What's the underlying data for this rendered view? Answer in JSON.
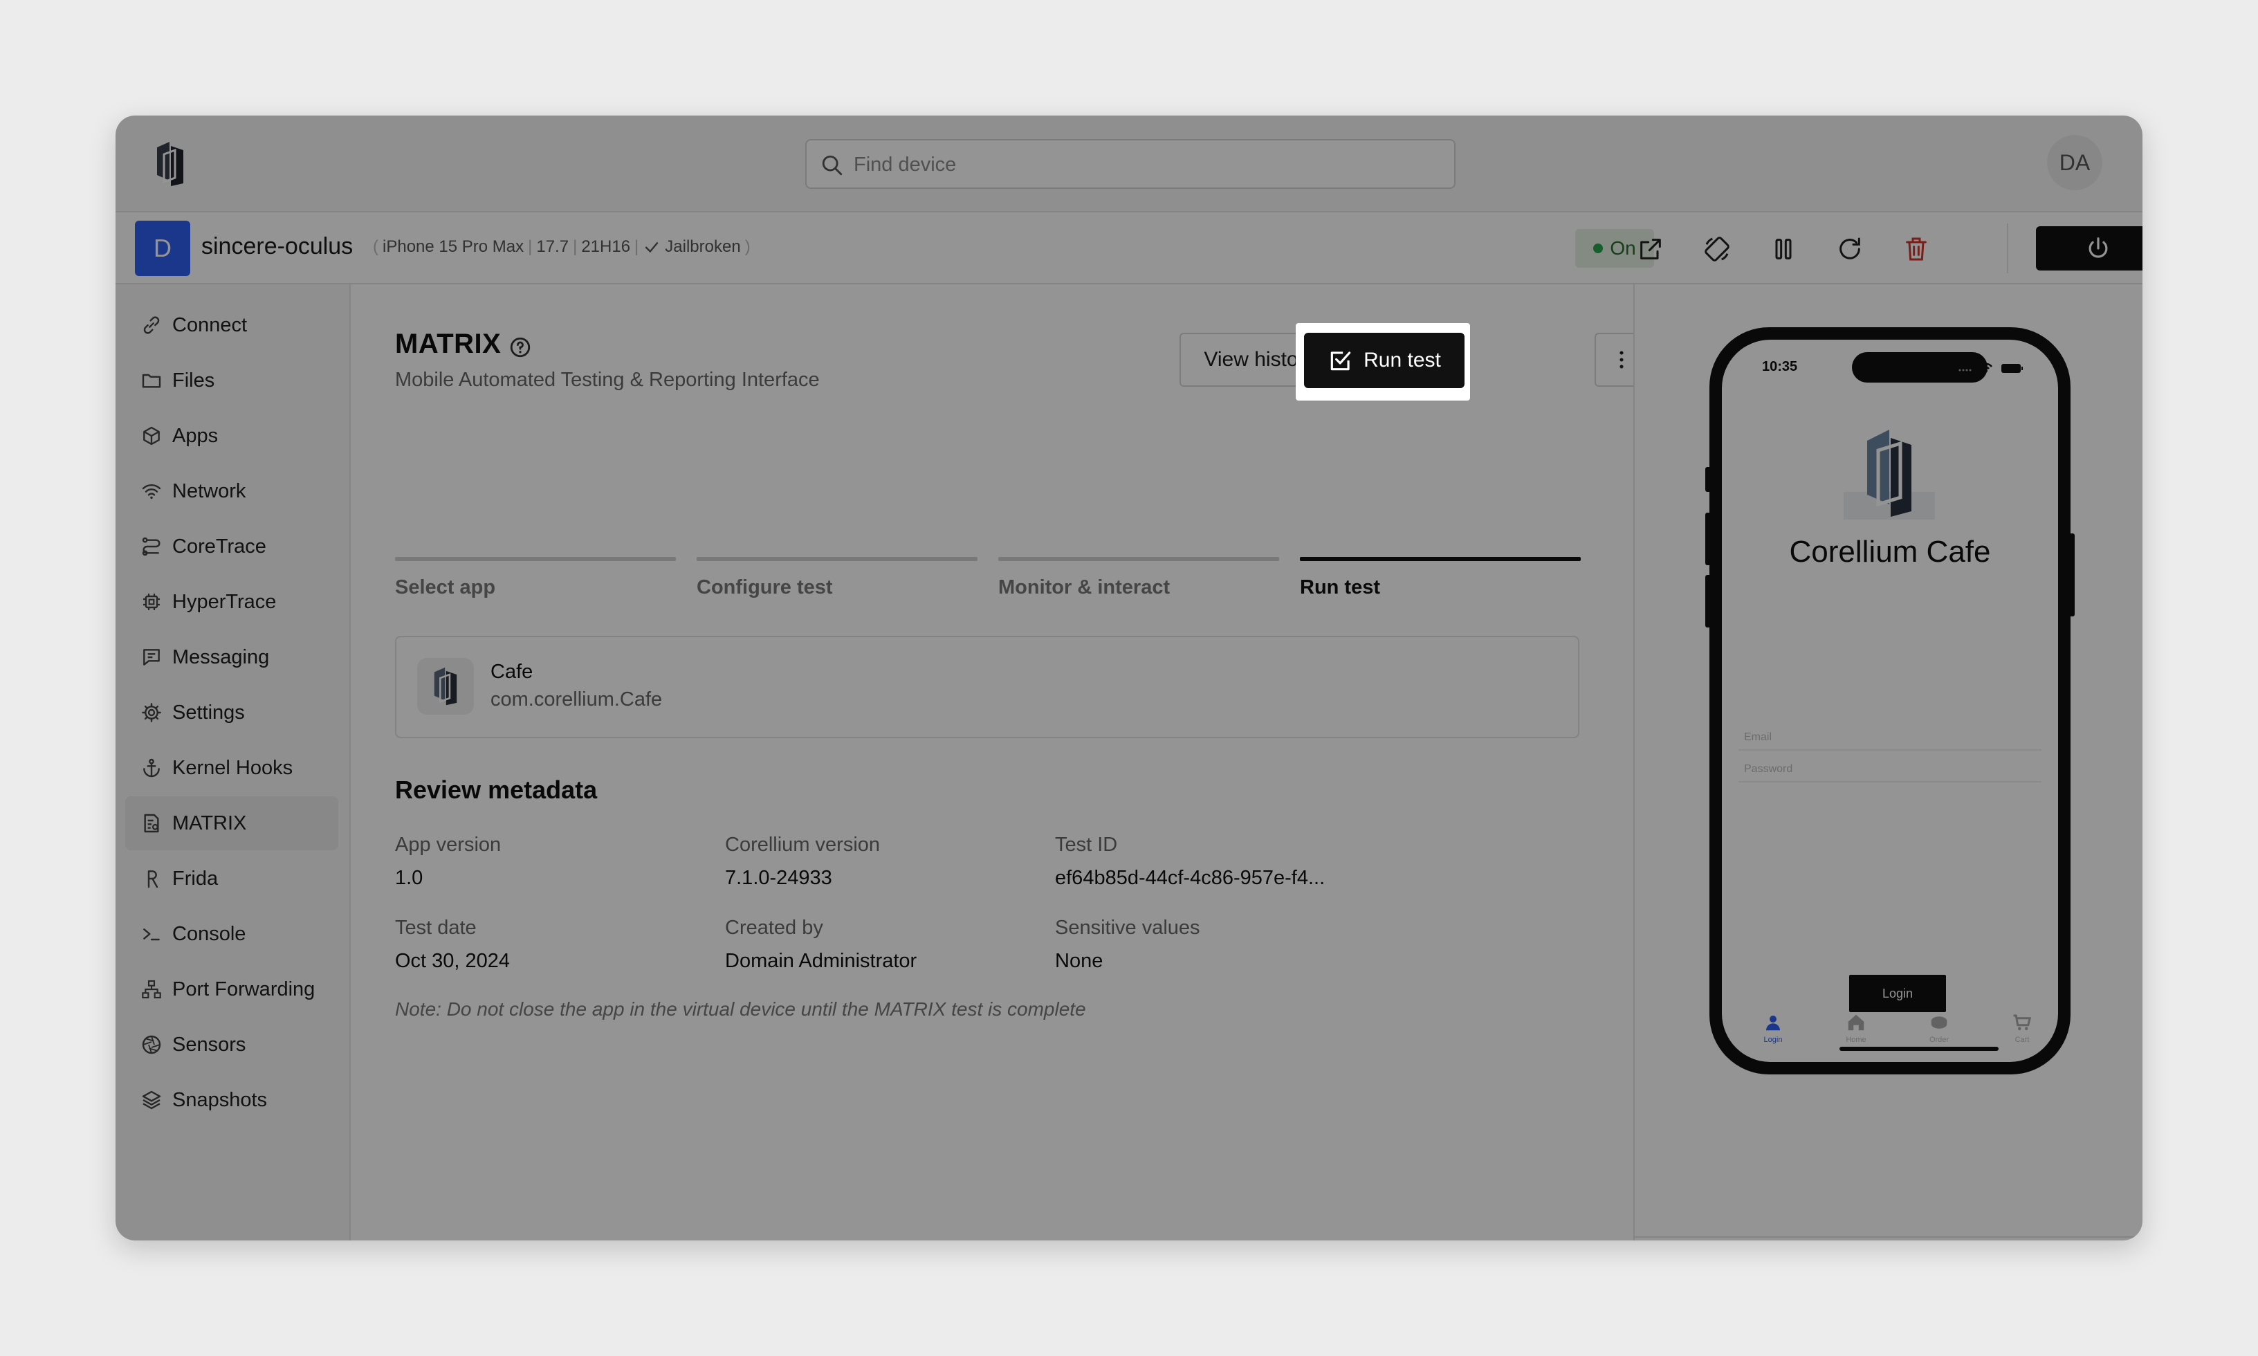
{
  "header": {
    "search_placeholder": "Find device",
    "user_initials": "DA"
  },
  "device": {
    "badge": "D",
    "name": "sincere-oculus",
    "model": "iPhone 15 Pro Max",
    "os_version": "17.7",
    "build": "21H16",
    "jailbreak": "Jailbroken",
    "status": "On",
    "status_color": "#27a34a",
    "toolbar_icons": [
      "external-link-icon",
      "rotate-icon",
      "pause-icon",
      "refresh-icon",
      "trash-icon",
      "power-icon"
    ]
  },
  "sidebar": {
    "items": [
      {
        "label": "Connect",
        "icon": "link-icon"
      },
      {
        "label": "Files",
        "icon": "folder-icon"
      },
      {
        "label": "Apps",
        "icon": "cube-icon"
      },
      {
        "label": "Network",
        "icon": "wifi-icon"
      },
      {
        "label": "CoreTrace",
        "icon": "coretrace-icon"
      },
      {
        "label": "HyperTrace",
        "icon": "chip-icon"
      },
      {
        "label": "Messaging",
        "icon": "message-icon"
      },
      {
        "label": "Settings",
        "icon": "gear-icon"
      },
      {
        "label": "Kernel Hooks",
        "icon": "anchor-icon"
      },
      {
        "label": "MATRIX",
        "icon": "report-icon",
        "active": true
      },
      {
        "label": "Frida",
        "icon": "frida-icon"
      },
      {
        "label": "Console",
        "icon": "terminal-icon"
      },
      {
        "label": "Port Forwarding",
        "icon": "network-tree-icon"
      },
      {
        "label": "Sensors",
        "icon": "aperture-icon"
      },
      {
        "label": "Snapshots",
        "icon": "layers-icon"
      }
    ]
  },
  "main": {
    "title": "MATRIX",
    "subtitle": "Mobile Automated Testing & Reporting Interface",
    "view_history_label": "View history",
    "run_test_label": "Run test",
    "steps": [
      {
        "label": "Select app",
        "done": false
      },
      {
        "label": "Configure test",
        "done": false
      },
      {
        "label": "Monitor & interact",
        "done": false
      },
      {
        "label": "Run test",
        "done": true
      }
    ],
    "app": {
      "name": "Cafe",
      "bundle_id": "com.corellium.Cafe"
    },
    "review_title": "Review metadata",
    "metadata": [
      {
        "label": "App version",
        "value": "1.0"
      },
      {
        "label": "Corellium version",
        "value": "7.1.0-24933"
      },
      {
        "label": "Test ID",
        "value": "ef64b85d-44cf-4c86-957e-f4..."
      },
      {
        "label": "Test date",
        "value": "Oct 30, 2024"
      },
      {
        "label": "Created by",
        "value": "Domain Administrator"
      },
      {
        "label": "Sensitive values",
        "value": "None"
      }
    ],
    "note": "Note: Do not close the app in the virtual device until the MATRIX test is complete"
  },
  "phone": {
    "time": "10:35",
    "app_title": "Corellium Cafe",
    "email_placeholder": "Email",
    "password_placeholder": "Password",
    "login_label": "Login",
    "tabs": [
      {
        "label": "Login",
        "icon": "person-icon",
        "active": true
      },
      {
        "label": "Home",
        "icon": "home-icon"
      },
      {
        "label": "Order",
        "icon": "coffee-icon"
      },
      {
        "label": "Cart",
        "icon": "cart-icon"
      }
    ],
    "controls": [
      "home-gesture-icon",
      "volume-down-icon",
      "volume-icon",
      "volume-up-icon",
      "keyboard-icon",
      "unlock-icon"
    ]
  },
  "colors": {
    "accent": "#111111",
    "brand_badge": "#2f5ff0",
    "danger": "#d0352b"
  }
}
